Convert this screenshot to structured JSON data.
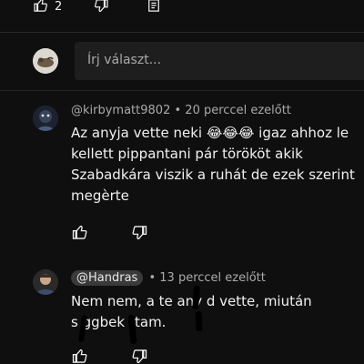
{
  "top_actions": {
    "like_count": "2",
    "like_icon": "thumbs-up-icon",
    "dislike_icon": "thumbs-down-icon",
    "note_icon": "note-icon"
  },
  "reply": {
    "placeholder": "Írj választ..."
  },
  "comments": [
    {
      "username": "@kirbymatt9802",
      "time": "20 perccel ezelőtt",
      "lines": [
        "Az anyja vette neki 😂😂😂 igaz ahhoz le",
        "kellett pippantani pár törököt akik",
        "Szabadkára viszik a ruhát de ezek szerint",
        "megèrte"
      ]
    },
    {
      "mention": "@Handras",
      "time": "13 perccel ezelőtt",
      "lines": [
        "Nem nem, a te any  d vette, miután",
        "s  ggbek   rtam."
      ]
    }
  ],
  "colors": {
    "background": "#0f0f0f",
    "meta_text": "#aaaaaa",
    "body_text": "#f1f1f1",
    "input_bg": "#1e1e1e",
    "mention_bg": "#3a3a3a"
  }
}
